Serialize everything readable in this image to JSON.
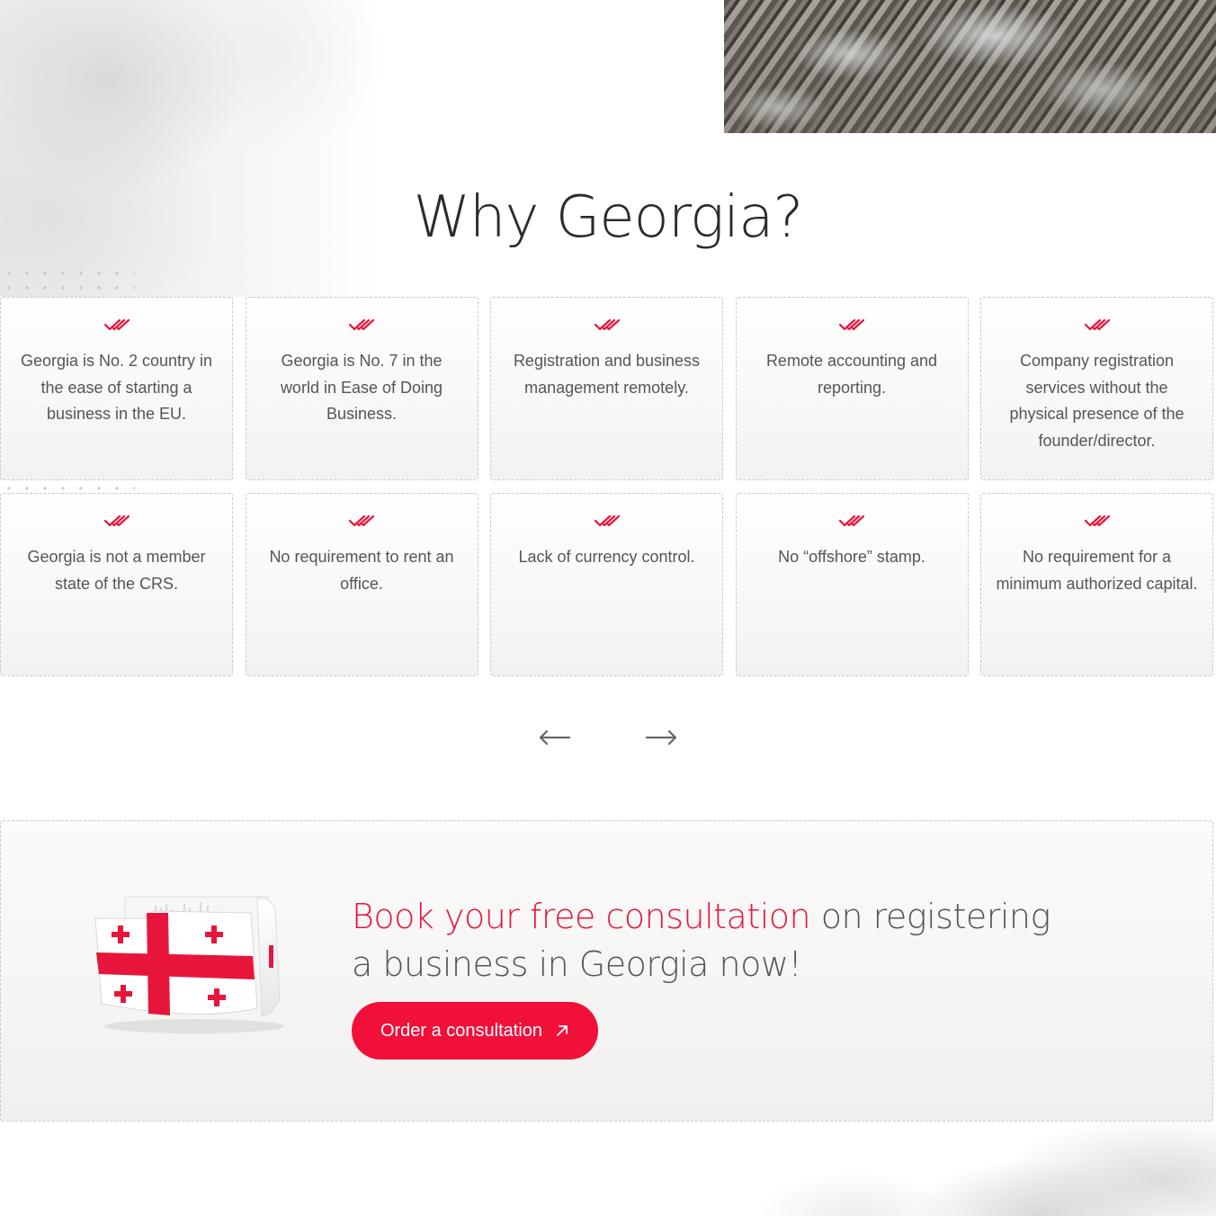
{
  "title": "Why Georgia?",
  "colors": {
    "accent": "#e8153b",
    "button": "#f0103a",
    "text": "#555555",
    "heading": "#2b2b2b"
  },
  "icons": {
    "card_icon": "double-check-icon",
    "prev": "arrow-left-icon",
    "next": "arrow-right-icon",
    "button_icon": "arrow-up-right-icon"
  },
  "cards": [
    {
      "text": "Georgia is No. 2 country in the ease of starting a business in the EU."
    },
    {
      "text": "Georgia is No. 7 in the world in Ease of Doing Business."
    },
    {
      "text": "Registration and business management remotely."
    },
    {
      "text": "Remote accounting and reporting."
    },
    {
      "text": "Company registration services without the physical presence of the founder/director."
    },
    {
      "text": "Georgia is not a member state of the CRS."
    },
    {
      "text": "No requirement to rent an office."
    },
    {
      "text": "Lack of currency control."
    },
    {
      "text": "No “offshore” stamp."
    },
    {
      "text": "No requirement for a minimum authorized capital."
    }
  ],
  "cta": {
    "heading_accent": "Book your free consultation",
    "heading_rest": " on registering a business in Georgia now!",
    "button_label": "Order a consultation"
  }
}
